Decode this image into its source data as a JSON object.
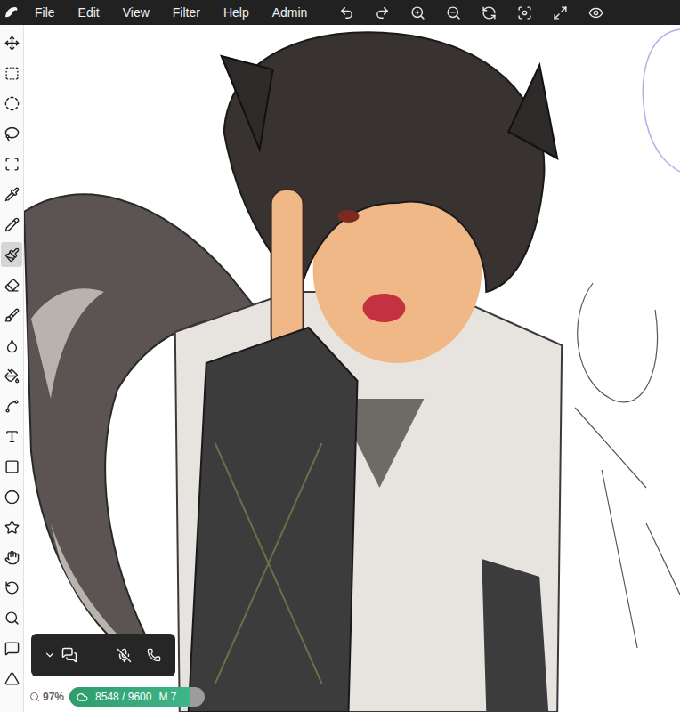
{
  "menu": {
    "items": [
      {
        "label": "File"
      },
      {
        "label": "Edit"
      },
      {
        "label": "View"
      },
      {
        "label": "Filter"
      },
      {
        "label": "Help"
      },
      {
        "label": "Admin"
      }
    ]
  },
  "tools": [
    {
      "selected": false
    },
    {
      "selected": false
    },
    {
      "selected": false
    },
    {
      "selected": false
    },
    {
      "selected": false
    },
    {
      "selected": false
    },
    {
      "selected": false
    },
    {
      "selected": true
    },
    {
      "selected": false
    },
    {
      "selected": false
    },
    {
      "selected": false
    },
    {
      "selected": false
    },
    {
      "selected": false
    },
    {
      "selected": false
    },
    {
      "selected": false
    },
    {
      "selected": false
    },
    {
      "selected": false
    },
    {
      "selected": false
    },
    {
      "selected": false
    },
    {
      "selected": false
    },
    {
      "selected": false
    },
    {
      "selected": false
    }
  ],
  "status": {
    "zoom": "97%",
    "usage": "8548 / 9600",
    "level": 0.89,
    "mode": "M 7"
  }
}
